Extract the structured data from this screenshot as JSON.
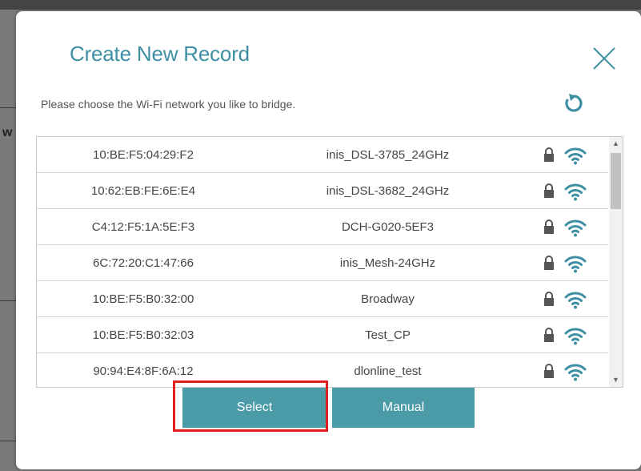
{
  "dialog": {
    "title": "Create New Record",
    "subtitle": "Please choose the Wi-Fi network you like to bridge.",
    "close_icon": "close-icon",
    "refresh_icon": "refresh-icon"
  },
  "networks": [
    {
      "mac": "10:BE:F5:04:29:F2",
      "ssid": "inis_DSL-3785_24GHz"
    },
    {
      "mac": "10:62:EB:FE:6E:E4",
      "ssid": "inis_DSL-3682_24GHz"
    },
    {
      "mac": "C4:12:F5:1A:5E:F3",
      "ssid": "DCH-G020-5EF3"
    },
    {
      "mac": "6C:72:20:C1:47:66",
      "ssid": "inis_Mesh-24GHz"
    },
    {
      "mac": "10:BE:F5:B0:32:00",
      "ssid": "Broadway"
    },
    {
      "mac": "10:BE:F5:B0:32:03",
      "ssid": "Test_CP"
    },
    {
      "mac": "90:94:E4:8F:6A:12",
      "ssid": "dlonline_test"
    }
  ],
  "buttons": {
    "select_label": "Select",
    "manual_label": "Manual"
  },
  "colors": {
    "accent": "#3e8fa3",
    "button": "#4a9aa8",
    "highlight": "#e0201e"
  }
}
